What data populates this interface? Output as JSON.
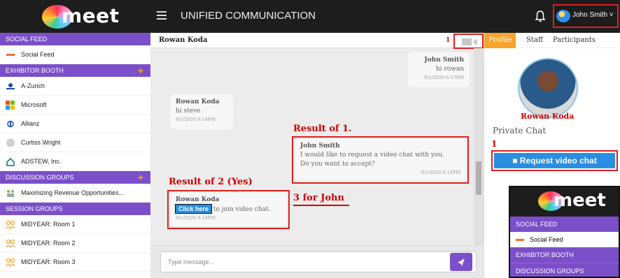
{
  "topbar": {
    "logo_text": "meet",
    "app_title": "UNIFIED COMMUNICATION",
    "user_name": "John Smith"
  },
  "sidebar": {
    "social_feed_header": "SOCIAL FEED",
    "social_feed_item": "Social Feed",
    "exhibitor_header": "EXHIBITOR BOOTH",
    "exhibitors": [
      "A-Zurich",
      "Microsoft",
      "Allianz",
      "Curtiss Wright",
      "ADSTEW, Inc."
    ],
    "discussion_header": "DISCUSSION GROUPS",
    "discussion_item": "Maximizing Revenue Opportunities...",
    "session_header": "SESSION GROUPS",
    "sessions": [
      "MIDYEAR: Room 1",
      "MIDYEAR: Room 2",
      "MIDYEAR: Room 3"
    ]
  },
  "chat": {
    "header_name": "Rowan Koda",
    "num_marker_top": "1",
    "messages": [
      {
        "name": "John Smith",
        "text": "hi rowan",
        "time": "9/1/2020 6:13PM"
      },
      {
        "name": "Rowan Koda",
        "text": "hi steve",
        "time": "9/1/2020 6:14PM"
      },
      {
        "name": "John Smith",
        "text": "I would like to request a video chat with you.",
        "text2": "Do you want to accept?",
        "time": "9/1/2020 6:14PM"
      },
      {
        "name": "Rowan Koda",
        "link": "Click here",
        "text": "to join video chat.",
        "time": "9/1/2020 6:14PM"
      }
    ],
    "annotation_1": "Result of 1.",
    "annotation_2": "Result of 2 (Yes)",
    "annotation_3": "3 for John",
    "input_placeholder": "Type message..."
  },
  "right_panel": {
    "tabs": [
      "Profile",
      "Staff",
      "Participants"
    ],
    "profile_name": "Rowan Koda",
    "private_chat_label": "Private Chat",
    "num_marker": "1",
    "request_button": "Request video chat"
  },
  "inset": {
    "logo_text": "meet",
    "rows": [
      "SOCIAL FEED",
      "Social Feed",
      "EXHIBITOR BOOTH",
      "DISCUSSION GROUPS"
    ]
  },
  "colors": {
    "accent_purple": "#7b4fc9",
    "accent_orange": "#f7a52b",
    "annotation_red": "#e02020",
    "button_blue": "#2a8fe0"
  }
}
